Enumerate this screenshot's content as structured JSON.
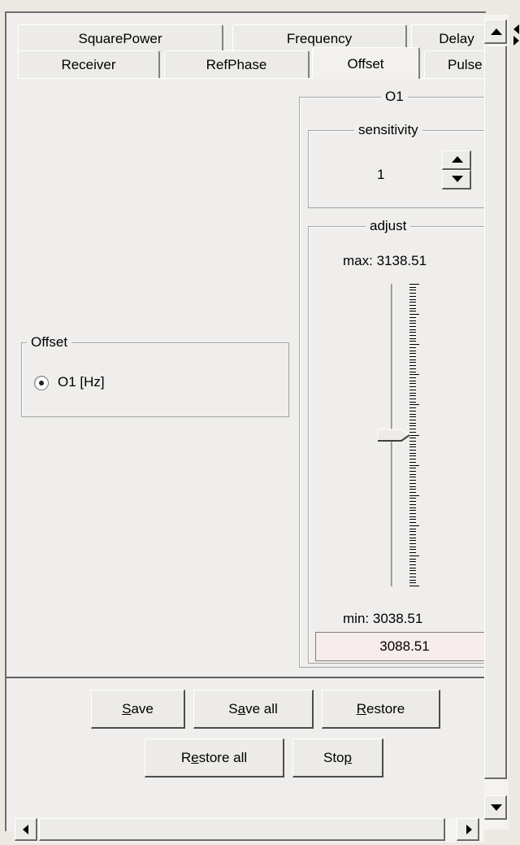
{
  "tabs": {
    "row1": [
      "SquarePower",
      "Frequency",
      "Delay"
    ],
    "row2": [
      "Receiver",
      "RefPhase",
      "Offset",
      "Pulse"
    ],
    "selected": "Offset"
  },
  "offset_group": {
    "title": "Offset",
    "radio_label": "O1 [Hz]",
    "radio_selected": true
  },
  "o1_panel": {
    "title": "O1",
    "sensitivity": {
      "title": "sensitivity",
      "value": "1"
    },
    "adjust": {
      "title": "adjust",
      "max_label": "max:",
      "max_value": "3138.51",
      "min_label": "min:",
      "min_value": "3038.51",
      "current_value": "3088.51",
      "slider_fraction": 0.5
    }
  },
  "buttons": {
    "save": {
      "pre": "",
      "ul": "S",
      "post": "ave"
    },
    "save_all": {
      "pre": "S",
      "ul": "a",
      "post": "ve all"
    },
    "restore": {
      "pre": "",
      "ul": "R",
      "post": "estore"
    },
    "restore_all": {
      "pre": "R",
      "ul": "e",
      "post": "store all"
    },
    "stop": {
      "pre": "Sto",
      "ul": "p",
      "post": ""
    }
  }
}
